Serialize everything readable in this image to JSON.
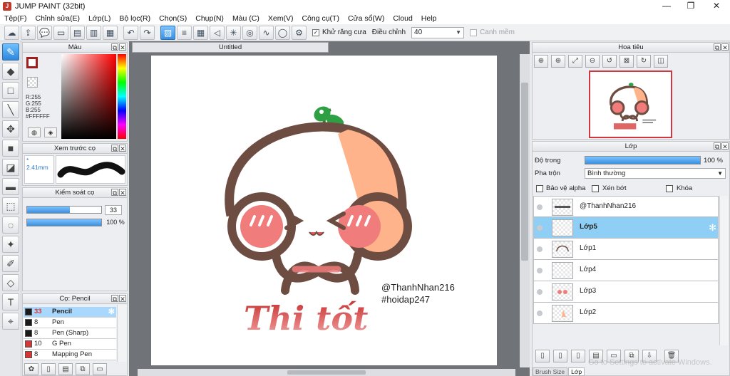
{
  "window": {
    "title": "JUMP PAINT (32bit)",
    "app_icon": "J",
    "minimize_icon": "minimize-icon",
    "maximize_icon": "maximize-icon",
    "close_icon": "close-icon"
  },
  "menu": {
    "items": [
      "Tệp(F)",
      "Chỉnh sửa(E)",
      "Lớp(L)",
      "Bộ lọc(R)",
      "Chọn(S)",
      "Chụp(N)",
      "Màu (C)",
      "Xem(V)",
      "Công cụ(T)",
      "Cửa sổ(W)",
      "Cloud",
      "Help"
    ]
  },
  "toolbar": {
    "antialias_label": "Khử răng cưa",
    "antialias_checked": true,
    "adjust_label": "Điều chỉnh",
    "adjust_value": "40",
    "margin_label": "Canh mềm"
  },
  "color_panel": {
    "title": "Màu",
    "fg_color": "#a11d1d",
    "rgb_r": "R:255",
    "rgb_g": "G:255",
    "rgb_b": "B:255",
    "hex": "#FFFFFF"
  },
  "preview_panel": {
    "title": "Xem trước cọ",
    "size_label": "* 2.41mm"
  },
  "control_panel": {
    "title": "Kiểm soát cọ",
    "size_value": "33",
    "size_fraction": 0.58,
    "opacity_value": "100 %",
    "opacity_fraction": 1.0
  },
  "brush_panel": {
    "title": "Cọ: Pencil",
    "brushes": [
      {
        "size": "33",
        "name": "Pencil",
        "color": "#1a1a1a",
        "selected": true
      },
      {
        "size": "8",
        "name": "Pen",
        "color": "#1a1a1a",
        "selected": false
      },
      {
        "size": "8",
        "name": "Pen (Sharp)",
        "color": "#1a1a1a",
        "selected": false
      },
      {
        "size": "10",
        "name": "G Pen",
        "color": "#d53636",
        "selected": false
      },
      {
        "size": "8",
        "name": "Mapping Pen",
        "color": "#d53636",
        "selected": false
      }
    ]
  },
  "canvas": {
    "tab_title": "Untitled",
    "handle_text": "@ThanhNhan216",
    "hashtag_text": "#hoidap247",
    "title_art_text": "Thi tốt"
  },
  "navigator": {
    "title": "Hoa tiêu"
  },
  "layer_panel": {
    "title": "Lớp",
    "opacity_label": "Độ trong",
    "opacity_value": "100 %",
    "blend_label": "Pha trộn",
    "blend_value": "Bình thường",
    "protect_alpha_label": "Bảo vệ alpha",
    "clipping_label": "Xén bớt",
    "lock_label": "Khóa",
    "layers": [
      {
        "name": "@ThanhNhan216",
        "thumb": "text",
        "selected": false
      },
      {
        "name": "Lớp5",
        "thumb": "",
        "selected": true
      },
      {
        "name": "Lớp1",
        "thumb": "outline",
        "selected": false
      },
      {
        "name": "Lớp4",
        "thumb": "",
        "selected": false
      },
      {
        "name": "Lớp3",
        "thumb": "dots",
        "selected": false
      },
      {
        "name": "Lớp2",
        "thumb": "fill",
        "selected": false
      }
    ],
    "bottom_tabs": [
      "Brush Size",
      "Lớp"
    ],
    "watermark": "Go to Settings to activate Windows."
  }
}
